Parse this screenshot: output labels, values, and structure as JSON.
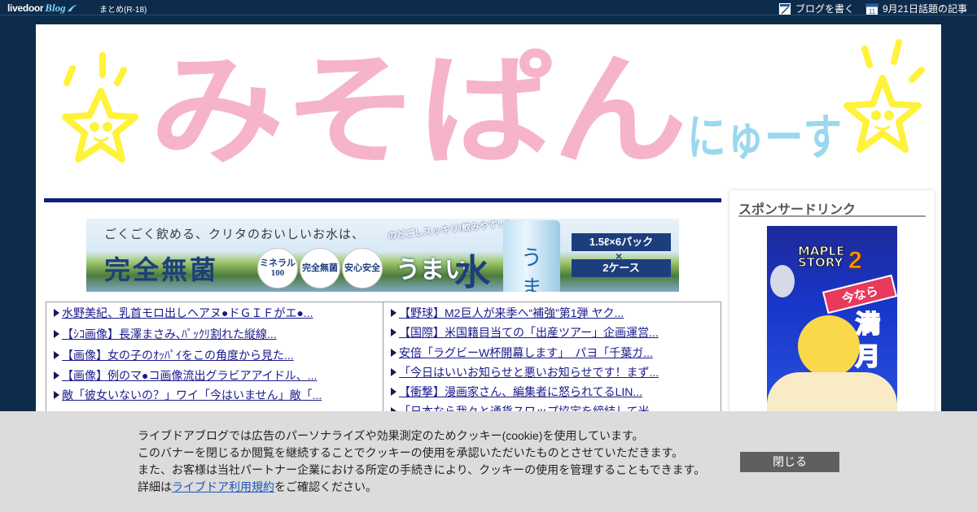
{
  "topbar": {
    "logo_text": "livedoor",
    "logo_blog": "Blog",
    "matome_link": "まとめ(R-18)",
    "write_blog": "ブログを書く",
    "calendar_day": "11",
    "topic_link": "9月21日話題の記事"
  },
  "header": {
    "title_main": "みそぱん",
    "title_sub": "にゅーす"
  },
  "ad_banner": {
    "copy": "ごくごく飲める、クリタのおいしいお水は、",
    "headline": "完全無菌",
    "badge1": "ミネラル100",
    "badge2": "完全無菌",
    "badge3": "安心安全",
    "catch": "のどごしスッキリ!飲みやすい!",
    "product1": "うまい",
    "product2": "水",
    "bottle_label": "うま水",
    "pack": "1.5ℓ×6パック",
    "times": "×",
    "cases": "2ケース"
  },
  "links": {
    "left": [
      "水野美紀、乳首モロ出しヘアヌ●ドＧＩＦがエ●...",
      "【ｼｺ画像】長澤まさみ､ﾊﾟｯｸﾘ割れた縦線...",
      "【画像】女の子のｵｯﾊﾟｲをこの角度から見た...",
      "【画像】例のマ●コ画像流出グラビアアイドル、...",
      "敵「彼女いないの？」ワイ「今はいません」敵「..."
    ],
    "right": [
      "【野球】M2巨人が来季へ“補強”第1弾 ヤク...",
      "【国際】米国籍目当ての「出産ツアー」企画運営...",
      "安倍「ラグビーW杯開幕します」　パヨ「千葉ガ...",
      "「今日はいいお知らせと悪いお知らせです！まず...",
      "【衝撃】漫画家さん、編集者に怒られてるLIN...",
      "「日本なら我々と通貨スワップ協定を締結して米..."
    ]
  },
  "sidebar": {
    "title": "スポンサードリンク",
    "ad_logo_line1": "MAPLE",
    "ad_logo_line2": "STORY",
    "ad_logo_num": "2",
    "ad_ima": "今なら",
    "ad_mangetsu": "満月熱"
  },
  "cookie": {
    "line1": "ライブドアブログでは広告のパーソナライズや効果測定のためクッキー(cookie)を使用しています。",
    "line2": "このバナーを閉じるか閲覧を継続することでクッキーの使用を承認いただいたものとさせていただきます。",
    "line3": "また、お客様は当社パートナー企業における所定の手続きにより、クッキーの使用を管理することもできます。",
    "line4_prefix": "詳細は",
    "line4_link": "ライブドア利用規約",
    "line4_suffix": "をご確認ください。",
    "close_button": "閉じる"
  },
  "colors": {
    "page_bg": "#0d2b4a",
    "title_pink": "#f6b4c8",
    "title_blue": "#9bd8ef",
    "star_yellow": "#fff23a",
    "rule_navy": "#0f1f7a",
    "link_blue": "#1a1a8c",
    "cookie_bg": "#dcdcdc",
    "close_btn": "#5f5f5f"
  }
}
